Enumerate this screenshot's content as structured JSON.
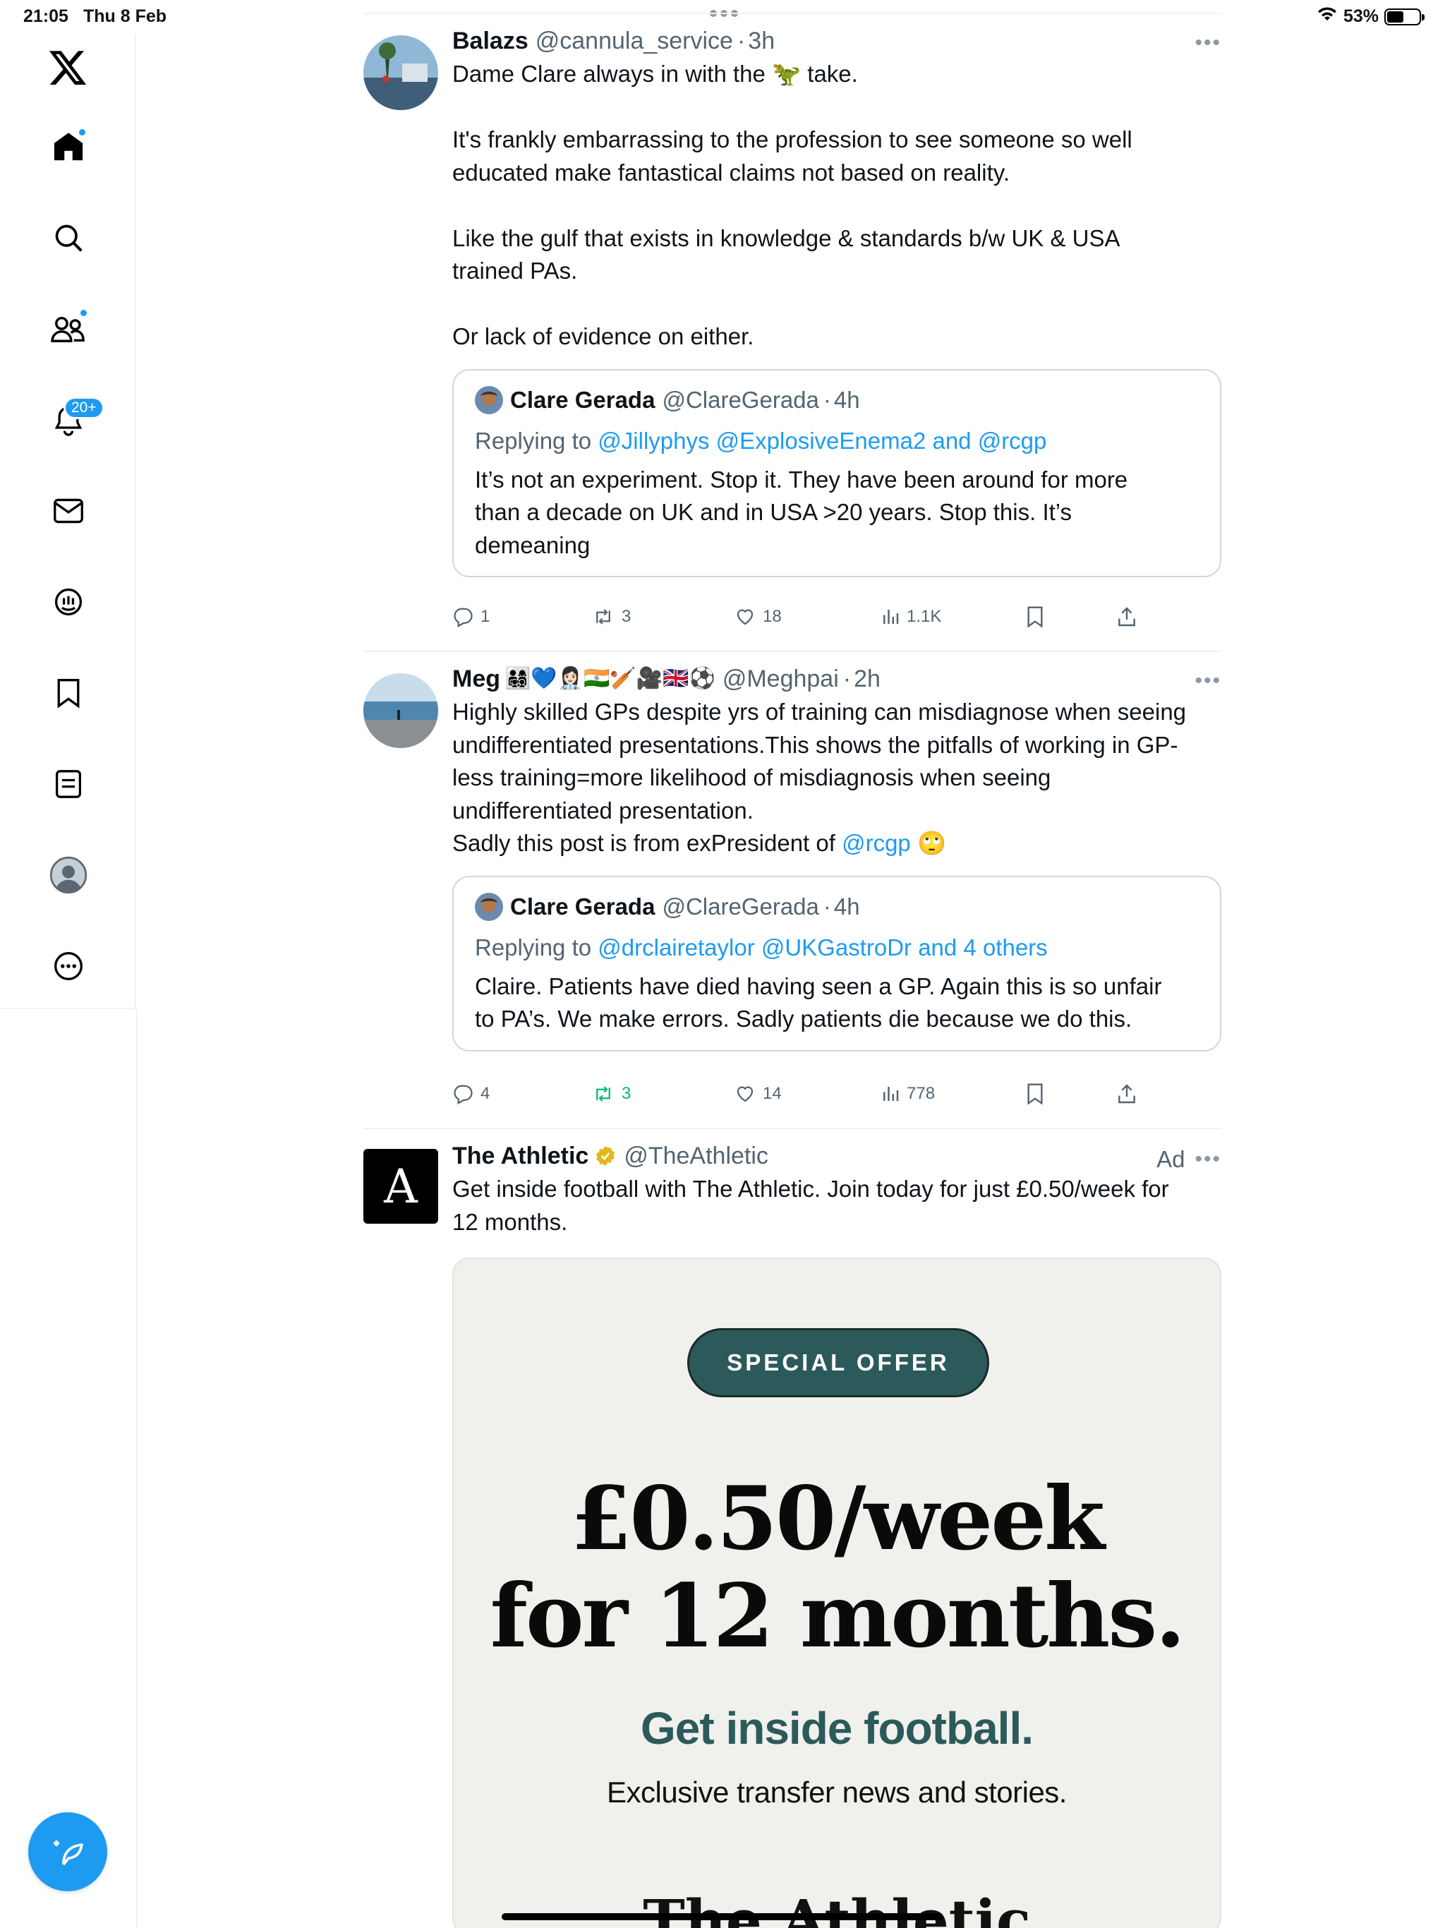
{
  "status": {
    "time": "21:05",
    "date": "Thu 8 Feb",
    "battery": "53%",
    "battery_level": 0.53
  },
  "sidebar": {
    "items": [
      {
        "name": "x-logo"
      },
      {
        "name": "home"
      },
      {
        "name": "explore"
      },
      {
        "name": "communities"
      },
      {
        "name": "notifications",
        "badge": "20+"
      },
      {
        "name": "messages"
      },
      {
        "name": "grok"
      },
      {
        "name": "bookmarks"
      },
      {
        "name": "lists"
      },
      {
        "name": "profile"
      },
      {
        "name": "more"
      }
    ]
  },
  "tweets": [
    {
      "name": "Balazs",
      "handle": "@cannula_service",
      "time": "3h",
      "text_pre": "Dame Clare always in with the ",
      "text_emoji": "🦖",
      "text_post": " take.\n\nIt's frankly embarrassing to the profession to see someone so well\neducated make fantastical claims not based on reality.\n\nLike the gulf that exists in knowledge & standards b/w UK & USA\ntrained PAs.\n\nOr lack of evidence on either.",
      "quote": {
        "name": "Clare Gerada",
        "handle": "@ClareGerada",
        "time": "4h",
        "replying_label": "Replying to",
        "replying_to": "@Jillyphys @ExplosiveEnema2 and @rcgp",
        "text": "It’s not an experiment. Stop it. They have been around for more\nthan a decade on UK and in USA >20 years. Stop this. It’s\ndemeaning"
      },
      "replies": "1",
      "reposts": "3",
      "likes": "18",
      "views": "1.1K"
    },
    {
      "name": "Meg",
      "name_emojis": "👨‍👩‍👧‍👦💙👩🏻‍⚕️🇮🇳🏏🎥🇬🇧⚽️",
      "handle": "@Meghpai",
      "time": "2h",
      "text": "Highly skilled GPs despite yrs of training can misdiagnose when seeing\nundifferentiated presentations.This shows the pitfalls of working in GP-\nless training=more likelihood of misdiagnosis when seeing\nundifferentiated presentation.\nSadly this post is from exPresident of ",
      "text_link": "@rcgp",
      "text_emoji": "🙄",
      "quote": {
        "name": "Clare Gerada",
        "handle": "@ClareGerada",
        "time": "4h",
        "replying_label": "Replying to",
        "replying_to": "@drclairetaylor @UKGastroDr and 4 others",
        "text": "Claire. Patients have died having seen a GP. Again this is so unfair\nto PA’s. We make errors. Sadly patients die because we do this."
      },
      "replies": "4",
      "reposts": "3",
      "likes": "14",
      "views": "778"
    },
    {
      "name": "The Athletic",
      "handle": "@TheAthletic",
      "ad_label": "Ad",
      "text": "Get inside football with The Athletic. Join today for just £0.50/week for\n12 months.",
      "promo": {
        "pill": "SPECIAL OFFER",
        "headline_line1": "£0.50/week",
        "headline_line2": "for 12 months.",
        "tagline": "Get inside football.",
        "subline": "Exclusive transfer news and stories.",
        "logo": "The Athletic"
      }
    }
  ],
  "colors": {
    "accent": "#1d9bf0",
    "repost_green": "#00ba7c",
    "promo_green": "#2c5a5b"
  }
}
